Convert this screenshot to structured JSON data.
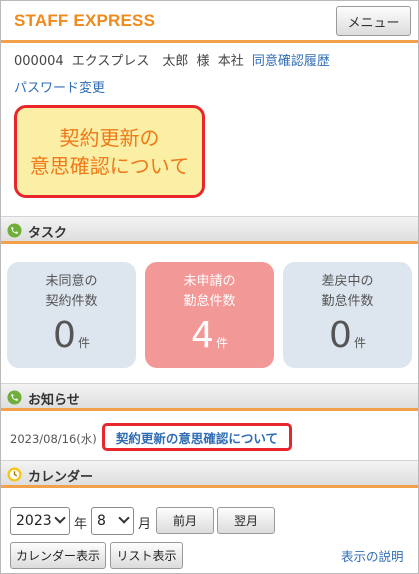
{
  "header": {
    "logo": "STAFF EXPRESS",
    "menu_label": "メニュー"
  },
  "user": {
    "id": "000004",
    "name": "エクスプレス　太郎",
    "honorific": "様",
    "branch": "本社",
    "consent_history_link": "同意確認履歴",
    "password_link": "パスワード変更"
  },
  "banner": {
    "line1": "契約更新の",
    "line2": "意思確認について"
  },
  "tasks": {
    "title": "タスク",
    "cards": [
      {
        "line1": "未同意の",
        "line2": "契約件数",
        "count": "0",
        "unit": "件",
        "highlight": false
      },
      {
        "line1": "未申請の",
        "line2": "勤怠件数",
        "count": "4",
        "unit": "件",
        "highlight": true
      },
      {
        "line1": "差戻中の",
        "line2": "勤怠件数",
        "count": "0",
        "unit": "件",
        "highlight": false
      }
    ]
  },
  "news": {
    "title": "お知らせ",
    "items": [
      {
        "date": "2023/08/16(水)",
        "text": "契約更新の意思確認について"
      }
    ]
  },
  "calendar": {
    "title": "カレンダー",
    "year": "2023",
    "year_unit": "年",
    "month": "8",
    "month_unit": "月",
    "prev_label": "前月",
    "next_label": "翌月",
    "calendar_view_label": "カレンダー表示",
    "list_view_label": "リスト表示",
    "help_link": "表示の説明"
  },
  "colors": {
    "accent": "#f2a14a",
    "brand": "#f08a1c",
    "alert_red": "#e8262b",
    "link": "#2f6db5",
    "card_default": "#dde5ee",
    "card_highlight": "#f29896",
    "banner_bg": "#fbefa6"
  }
}
